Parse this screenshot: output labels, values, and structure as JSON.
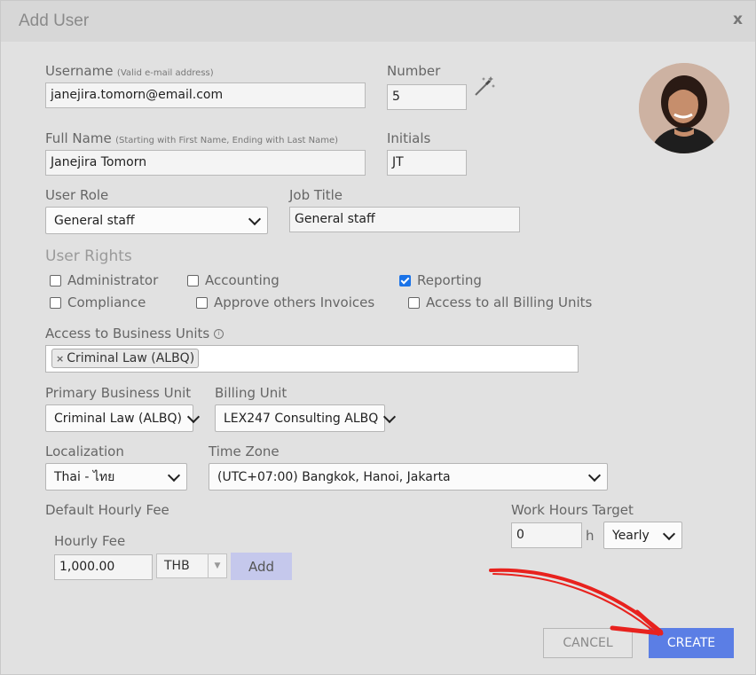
{
  "dialog": {
    "title": "Add User",
    "close": "x"
  },
  "username": {
    "label": "Username",
    "hint": "(Valid e-mail address)",
    "value": "janejira.tomorn@email.com"
  },
  "number": {
    "label": "Number",
    "value": "5",
    "icon": "magic-wand-icon"
  },
  "full_name": {
    "label": "Full Name",
    "hint": "(Starting with First Name, Ending with Last Name)",
    "value": "Janejira Tomorn"
  },
  "initials": {
    "label": "Initials",
    "value": "JT"
  },
  "user_role": {
    "label": "User Role",
    "value": "General staff"
  },
  "job_title": {
    "label": "Job Title",
    "value": "General staff"
  },
  "rights": {
    "label": "User Rights",
    "items": [
      {
        "label": "Administrator",
        "checked": false
      },
      {
        "label": "Accounting",
        "checked": false
      },
      {
        "label": "Reporting",
        "checked": true
      },
      {
        "label": "Compliance",
        "checked": false
      },
      {
        "label": "Approve others Invoices",
        "checked": false
      },
      {
        "label": "Access to all Billing Units",
        "checked": false
      }
    ]
  },
  "business_units": {
    "label": "Access to Business Units",
    "info_icon": "info-icon",
    "tags": [
      "Criminal Law (ALBQ)"
    ],
    "remove": "×"
  },
  "primary_bu": {
    "label": "Primary Business Unit",
    "value": "Criminal Law (ALBQ)"
  },
  "billing_unit": {
    "label": "Billing Unit",
    "value": "LEX247 Consulting ALBQ"
  },
  "localization": {
    "label": "Localization",
    "value": "Thai - ไทย"
  },
  "time_zone": {
    "label": "Time Zone",
    "value": "(UTC+07:00) Bangkok, Hanoi, Jakarta"
  },
  "hourly": {
    "section": "Default Hourly Fee",
    "label": "Hourly Fee",
    "value": "1,000.00",
    "currency": "THB",
    "add": "Add"
  },
  "work_hours": {
    "label": "Work Hours Target",
    "value": "0",
    "unit": "h",
    "period": "Yearly"
  },
  "footer": {
    "cancel": "CANCEL",
    "create": "CREATE"
  },
  "colors": {
    "create_bg": "#5b7ee5",
    "add_bg": "#c5c8ec",
    "annotation_arrow": "#e8221e"
  }
}
